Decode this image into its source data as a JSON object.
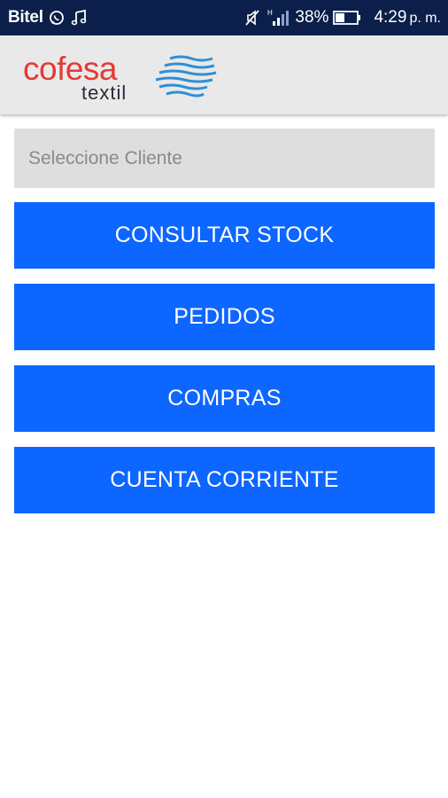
{
  "status_bar": {
    "carrier": "Bitel",
    "battery": "38%",
    "time": "4:29",
    "time_suffix": "p. m.",
    "network": "H",
    "icons": [
      "whatsapp-icon",
      "music-note-icon",
      "mute-icon",
      "signal-icon",
      "battery-icon"
    ]
  },
  "header": {
    "logo_word": "cofesa",
    "logo_sub": "textil",
    "logo_colors": {
      "word": "#e53935",
      "sub": "#2a2a3a",
      "waves": "#2f8fd6"
    }
  },
  "client_selector": {
    "placeholder": "Seleccione Cliente"
  },
  "menu": {
    "items": [
      {
        "label": "CONSULTAR STOCK"
      },
      {
        "label": "PEDIDOS"
      },
      {
        "label": "COMPRAS"
      },
      {
        "label": "CUENTA CORRIENTE"
      }
    ]
  },
  "colors": {
    "status_bar": "#0b1f4a",
    "app_bar": "#e9e9e9",
    "button": "#0d66ff",
    "selector_bg": "#dedede"
  }
}
